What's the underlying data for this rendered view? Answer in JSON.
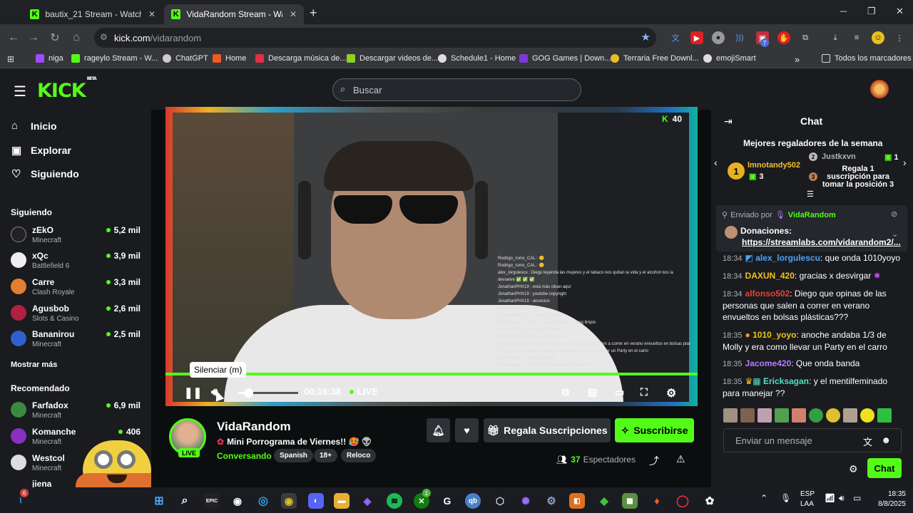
{
  "browser": {
    "tabs": [
      {
        "title": "bautix_21 Stream - Watch Live o",
        "close": "✕"
      },
      {
        "title": "VidaRandom Stream - Watch Li",
        "close": "✕"
      }
    ],
    "new_tab": "+",
    "url_domain": "kick.com",
    "url_path": "/vidarandom",
    "bookmarks": [
      "niga",
      "rageylo Stream - W...",
      "ChatGPT",
      "Home",
      "Descarga música de...",
      "Descargar videos de...",
      "Schedule1 - Home",
      "GOG Games | Down...",
      "Terraria Free Downl...",
      "emojiSmart"
    ],
    "bookmarks_overflow": "»",
    "all_bookmarks": "Todos los marcadores",
    "ext_badge": "7"
  },
  "kick": {
    "logo": "KICK",
    "logo_badge": "BETA",
    "search_placeholder": "Buscar"
  },
  "sidebar": {
    "nav": [
      {
        "label": "Inicio",
        "icon": "home-icon"
      },
      {
        "label": "Explorar",
        "icon": "explore-icon"
      },
      {
        "label": "Siguiendo",
        "icon": "heart-icon"
      }
    ],
    "following_title": "Siguiendo",
    "following": [
      {
        "name": "zEkO",
        "game": "Minecraft",
        "viewers": "5,2 mil"
      },
      {
        "name": "xQc",
        "game": "Battlefield 6",
        "viewers": "3,9 mil"
      },
      {
        "name": "Carre",
        "game": "Clash Royale",
        "viewers": "3,3 mil"
      },
      {
        "name": "Agusbob",
        "game": "Slots & Casino",
        "viewers": "2,6 mil"
      },
      {
        "name": "Bananirou",
        "game": "Minecraft",
        "viewers": "2,5 mil"
      }
    ],
    "show_more": "Mostrar más",
    "recommended_title": "Recomendado",
    "recommended": [
      {
        "name": "Farfadox",
        "game": "Minecraft",
        "viewers": "6,9 mil"
      },
      {
        "name": "Komanche",
        "game": "Minecraft",
        "viewers": "406"
      },
      {
        "name": "Westcol",
        "game": "Minecraft",
        "viewers": ""
      },
      {
        "name": "jiena",
        "game": "",
        "viewers": ""
      }
    ]
  },
  "player": {
    "viewer_badge": "40",
    "tooltip": "Silenciar (m)",
    "time": "00:16:38",
    "live": "LIVE",
    "overlay_chat": [
      "Rodrigo_roms_CAL : 🙂",
      "Rodrigo_roms_CAL : 🙂",
      "alex_lorgulescu : Diego leyenda las mujeres y el tabaco nos quitan la vida y el alcohol nos la devuelve ✅ ✅ ✅",
      "JonathanPHX19 : está más clean aquí",
      "JonathanPHX19 : youtube copyright",
      "JonathanPHX19 : anuncios",
      "JonathanPHX19 : tax",
      "JonathanPHX19 : stream atrasado",
      "Rodrigo_roms_CAL : aca disfrutando el bong limpio",
      "alfonso502 : que onda 1010yoyo",
      "DAXUN_420 : gracias x desvirgar",
      "alfonso502 : Diego que opinas de las personas que salen a correr en verano envueltos en bolsas plasticas??",
      "1010_yoyo : anoche andaba 1/3 de Molly y era como llevar un Party en el carro",
      "Jacome420 : Que onda banda",
      "Ericksagan : y el mentilfeminado para manejar ??"
    ]
  },
  "stream": {
    "channel": "VidaRandom",
    "live_tag": "LIVE",
    "title": "Mini Porrograma de Viernes!! 🥵 👽",
    "category": "Conversando",
    "tags": [
      "Spanish",
      "18+",
      "Reloco"
    ],
    "gift_button": "Regala Suscripciones",
    "subscribe_button": "Suscribirse",
    "viewer_count": "37",
    "viewer_label": "Espectadores"
  },
  "chat": {
    "title": "Chat",
    "gifters_title": "Mejores regaladores de la semana",
    "top_gifter": {
      "rank": "1",
      "name": "lmnotandy502",
      "count": "3"
    },
    "second_gifter": {
      "rank": "2",
      "name": "Justkxvn",
      "count": "1"
    },
    "third_gifter": {
      "rank": "3",
      "text": "Regala 1 suscripción para tomar la posición 3"
    },
    "pinned_label": "Enviado por",
    "pinned_user": "VidaRandom",
    "pinned_title": "Donaciones:",
    "pinned_link": "https://streamlabs.com/vidarandom2/...",
    "messages": [
      {
        "time": "18:34",
        "user": "alex_lorgulescu",
        "text": "que onda 1010yoyo",
        "color": "#4aa3ff"
      },
      {
        "time": "18:34",
        "user": "DAXUN_420",
        "text": "gracias x desvirgar",
        "color": "#f2c21b"
      },
      {
        "time": "18:34",
        "user": "alfonso502",
        "text": "Diego que opinas de las personas que salen a correr en verano envueltos en bolsas plásticas???",
        "color": "#e0453a"
      },
      {
        "time": "18:35",
        "user": "1010_yoyo",
        "text": "anoche andaba 1/3 de Molly y era como llevar un Party en el carro",
        "color": "#f2c21b"
      },
      {
        "time": "18:35",
        "user": "Jacome420",
        "text": "Que onda banda",
        "color": "#b57bff"
      },
      {
        "time": "18:35",
        "user": "Ericksagan",
        "text": "y el mentilfeminado para manejar ??",
        "color": "#53e0c0"
      }
    ],
    "input_placeholder": "Enviar un mensaje",
    "send_button": "Chat"
  },
  "taskbar": {
    "lang": "ESP",
    "region": "LAA",
    "time": "18:35",
    "date": "8/8/2025",
    "badge_discord": "6",
    "badge_xbox": "1"
  },
  "colors": {
    "kick_green": "#53fc18",
    "panel": "#191b1f",
    "bg": "#0b0e0f"
  }
}
